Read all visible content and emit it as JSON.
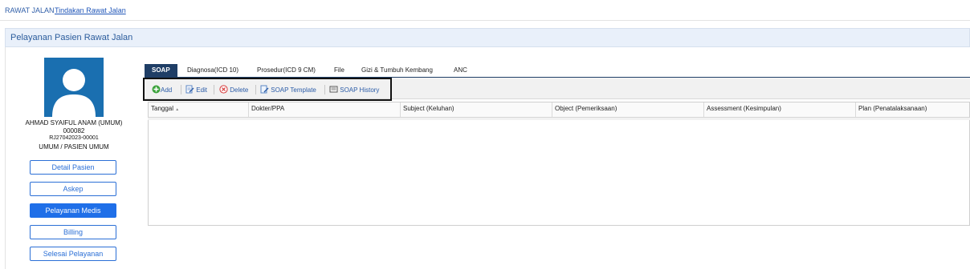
{
  "breadcrumb": {
    "root": "RAWAT JALAN",
    "current": "Tindakan Rawat Jalan"
  },
  "panel": {
    "title": "Pelayanan Pasien Rawat Jalan"
  },
  "patient": {
    "name": "AHMAD SYAIFUL ANAM (UMUM)",
    "number": "000082",
    "visit_id": "RJ27042023-00001",
    "category": "UMUM / PASIEN UMUM"
  },
  "side_menu": [
    {
      "label": "Detail Pasien",
      "active": false
    },
    {
      "label": "Askep",
      "active": false
    },
    {
      "label": "Pelayanan Medis",
      "active": true
    },
    {
      "label": "Billing",
      "active": false
    },
    {
      "label": "Selesai Pelayanan",
      "active": false
    }
  ],
  "tabs": [
    {
      "label": "SOAP",
      "active": true
    },
    {
      "label": "Diagnosa(ICD 10)",
      "active": false
    },
    {
      "label": "Prosedur(ICD 9 CM)",
      "active": false
    },
    {
      "label": "File",
      "active": false
    },
    {
      "label": "Gizi & Tumbuh Kembang",
      "active": false
    },
    {
      "label": "ANC",
      "active": false
    }
  ],
  "toolbar": {
    "add": "Add",
    "edit": "Edit",
    "delete": "Delete",
    "soap_template": "SOAP Template",
    "soap_history": "SOAP History"
  },
  "grid": {
    "columns": [
      "Tanggal",
      "Dokter/PPA",
      "Subject (Keluhan)",
      "Object (Pemeriksaan)",
      "Assessment (Kesimpulan)",
      "Plan (Penatalaksanaan)"
    ],
    "sort_indicator": "▲",
    "rows": []
  },
  "icons": {
    "add": "plus-circle-icon",
    "edit": "edit-document-icon",
    "delete": "delete-circle-icon",
    "template": "template-document-icon",
    "history": "history-list-icon"
  },
  "colors": {
    "accent": "#1f6fe8",
    "tab_active": "#1f3e66",
    "avatar_bg": "#1a6fb0",
    "link": "#2b5ca8"
  }
}
